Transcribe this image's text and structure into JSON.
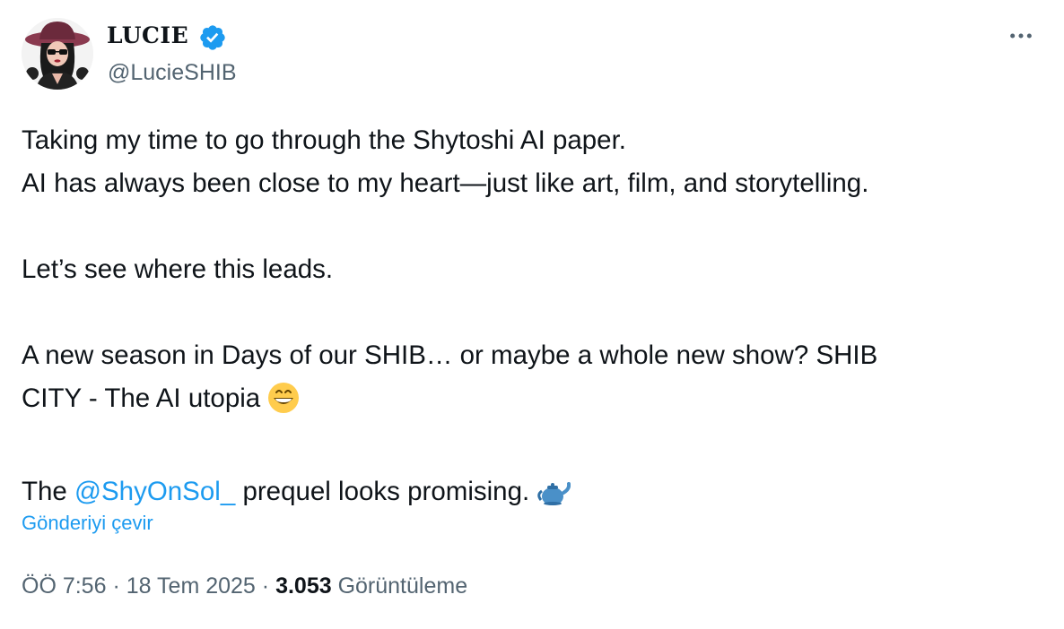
{
  "author": {
    "display_name": "LUCIE",
    "handle": "@LucieSHIB",
    "verified": true
  },
  "tweet": {
    "line1": "Taking my time to go through the Shytoshi AI paper.",
    "line2": "AI has always been close to my heart—just like art, film, and storytelling.",
    "line3": "Let’s see where this leads.",
    "line4a": "A new season in Days of our SHIB… or maybe a whole new show? SHIB",
    "line4b": "CITY - The AI utopia",
    "line5_prefix": "The",
    "mention": "@ShyOnSol_",
    "line5_suffix": "prequel looks promising.",
    "emoji1": "grinning-face-emoji",
    "emoji2": "teapot-emoji"
  },
  "translate_label": "Gönderiyi çevir",
  "meta": {
    "time": "ÖÖ 7:56",
    "date": "18 Tem 2025",
    "separator": "·",
    "views_count": "3.053",
    "views_label": "Görüntüleme"
  },
  "colors": {
    "accent": "#1d9bf0",
    "secondary_text": "#536471",
    "primary_text": "#0f1419"
  },
  "icons": {
    "more": "more-horizontal-icon",
    "verified": "verified-badge-icon"
  }
}
